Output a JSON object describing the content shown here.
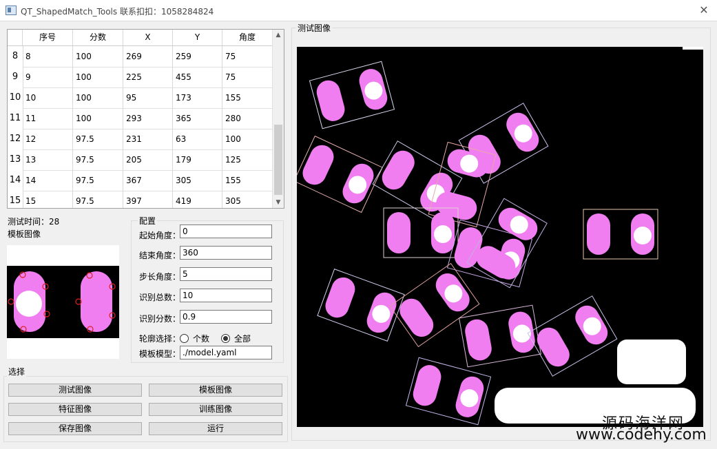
{
  "window": {
    "title": "QT_ShapedMatch_Tools   联系扣扣：1058284824",
    "close_glyph": "✕"
  },
  "table": {
    "columns": [
      "序号",
      "分数",
      "X",
      "Y",
      "角度"
    ],
    "rows": [
      {
        "num": "8",
        "cells": [
          "8",
          "100",
          "269",
          "259",
          "75"
        ]
      },
      {
        "num": "9",
        "cells": [
          "9",
          "100",
          "225",
          "455",
          "75"
        ]
      },
      {
        "num": "10",
        "cells": [
          "10",
          "100",
          "95",
          "173",
          "155"
        ]
      },
      {
        "num": "11",
        "cells": [
          "11",
          "100",
          "293",
          "365",
          "280"
        ]
      },
      {
        "num": "12",
        "cells": [
          "12",
          "97.5",
          "231",
          "63",
          "100"
        ]
      },
      {
        "num": "13",
        "cells": [
          "13",
          "97.5",
          "205",
          "179",
          "125"
        ]
      },
      {
        "num": "14",
        "cells": [
          "14",
          "97.5",
          "367",
          "305",
          "155"
        ]
      },
      {
        "num": "15",
        "cells": [
          "15",
          "97.5",
          "397",
          "419",
          "305"
        ]
      }
    ]
  },
  "status": {
    "test_time": "测试时间：28"
  },
  "template": {
    "label": "模板图像"
  },
  "config": {
    "title": "配置",
    "start_angle_label": "起始角度：",
    "start_angle": "0",
    "end_angle_label": "结束角度：",
    "end_angle": "360",
    "step_angle_label": "步长角度：",
    "step_angle": "5",
    "total_label": "识别总数：",
    "total": "10",
    "score_label": "识别分数：",
    "score": "0.9",
    "contour_label": "轮廓选择：",
    "option_count": "个数",
    "option_all": "全部",
    "selected_option": "全部",
    "model_label": "模板模型：",
    "model_path": "./model.yaml"
  },
  "select": {
    "title": "选择",
    "buttons": [
      "测试图像",
      "模板图像",
      "特征图像",
      "训练图像",
      "保存图像",
      "运行"
    ]
  },
  "test_image": {
    "label": "测试图像"
  },
  "watermark": {
    "line1": "源码海洋网",
    "line2": "www.codehy.com"
  }
}
